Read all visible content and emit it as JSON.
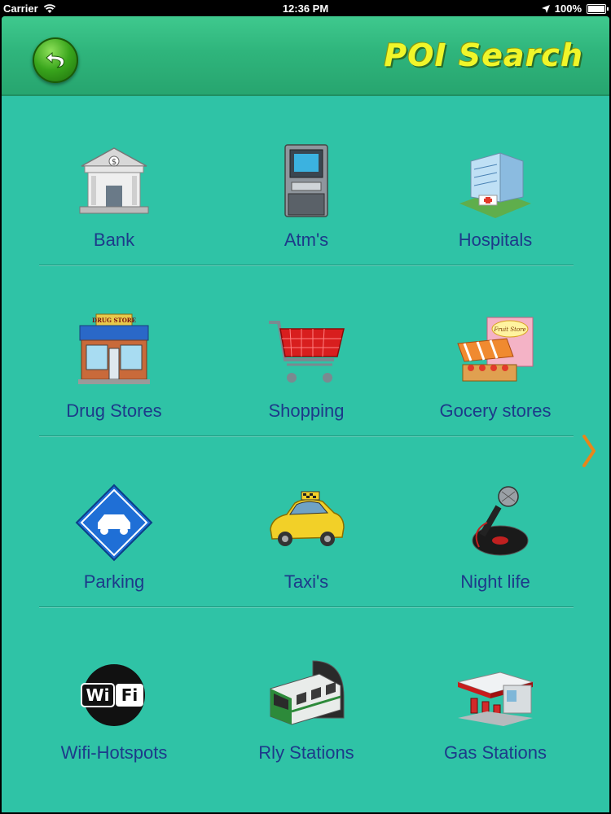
{
  "status_bar": {
    "carrier": "Carrier",
    "time": "12:36 PM",
    "battery": "100%",
    "battery_level": 1.0
  },
  "header": {
    "title": "POI Search",
    "back_icon": "back-arrow-icon"
  },
  "categories": [
    {
      "label": "Bank",
      "icon": "bank-icon"
    },
    {
      "label": "Atm's",
      "icon": "atm-icon"
    },
    {
      "label": "Hospitals",
      "icon": "hospital-icon"
    },
    {
      "label": "Drug Stores",
      "icon": "drug-store-icon"
    },
    {
      "label": "Shopping",
      "icon": "shopping-cart-icon"
    },
    {
      "label": "Gocery stores",
      "icon": "fruit-store-icon"
    },
    {
      "label": "Parking",
      "icon": "parking-icon"
    },
    {
      "label": "Taxi's",
      "icon": "taxi-icon"
    },
    {
      "label": "Night life",
      "icon": "microphone-icon"
    },
    {
      "label": "Wifi-Hotspots",
      "icon": "wifi-icon"
    },
    {
      "label": "Rly Stations",
      "icon": "train-icon"
    },
    {
      "label": "Gas Stations",
      "icon": "gas-station-icon"
    }
  ],
  "wifi_icon_text": {
    "left": "Wi",
    "right": "Fi"
  },
  "drug_store_sign": "DRUG STORE",
  "fruit_store_sign": "Fruit Store",
  "next_icon": "chevron-right-icon",
  "colors": {
    "background": "#2fc3a6",
    "header": "#2fb57c",
    "title": "#f0f62a",
    "label": "#1d3a8a",
    "chevron": "#e8861a"
  }
}
